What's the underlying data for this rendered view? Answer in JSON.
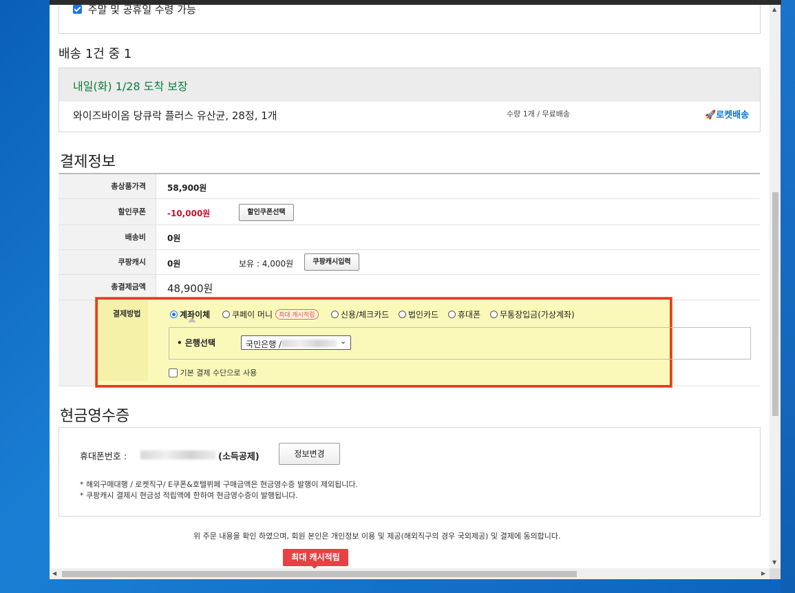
{
  "weekend": {
    "label": "주말 및 공휴일 수령 가능"
  },
  "shipment": {
    "title": "배송 1건 중 1",
    "arrival": "내일(화) 1/28 도착 보장",
    "product": "와이즈바이옴 당큐락 플러스 유산균, 28정, 1개",
    "qty_info": "수량 1개 / 무료배송",
    "badge": "로켓배송"
  },
  "payment": {
    "title": "결제정보",
    "rows": {
      "total_price": {
        "label": "총상품가격",
        "value": "58,900원"
      },
      "coupon": {
        "label": "할인쿠폰",
        "value": "-10,000원",
        "button": "할인쿠폰선택"
      },
      "shipping": {
        "label": "배송비",
        "value": "0원"
      },
      "cash": {
        "label": "쿠팡캐시",
        "value": "0원",
        "hold": "보유 : 4,000원",
        "button": "쿠팡캐시입력"
      },
      "grand_total": {
        "label": "총결제금액",
        "value": "48,900원"
      }
    },
    "method": {
      "label": "결제방법",
      "options": [
        "계좌이체",
        "쿠페이 머니",
        "신용/체크카드",
        "법인카드",
        "휴대폰",
        "무통장입금(가상계좌)"
      ],
      "coupay_badge": "최대 캐시적립",
      "bank_label": "• 은행선택",
      "bank_value": "국민은행 /",
      "default_label": "기본 결제 수단으로 사용"
    }
  },
  "receipt": {
    "title": "현금영수증",
    "phone_label": "휴대폰번호 :",
    "deduction": "(소득공제)",
    "button": "정보변경",
    "note1": "* 해외구매대행 / 로켓직구/ E쿠폰&호텔뷔페 구매금액은 현금영수증 발행이 제외됩니다.",
    "note2": "* 쿠팡캐시 결제시 현금성 적립액에 한하여 현금영수증이 발행됩니다."
  },
  "agreement": "위 주문 내용을 확인 하였으며, 회원 본인은 개인정보 이용 및 제공(해외직구의 경우 국외제공) 및 결제에 동의합니다.",
  "cta_badge": "최대 캐시적립",
  "colors": {
    "arrival": "#0a7a3d",
    "discount": "#c8102e",
    "highlight_border": "#e63b1f",
    "highlight_bg": "#fbf9b9",
    "rocket": "#0073e9"
  }
}
